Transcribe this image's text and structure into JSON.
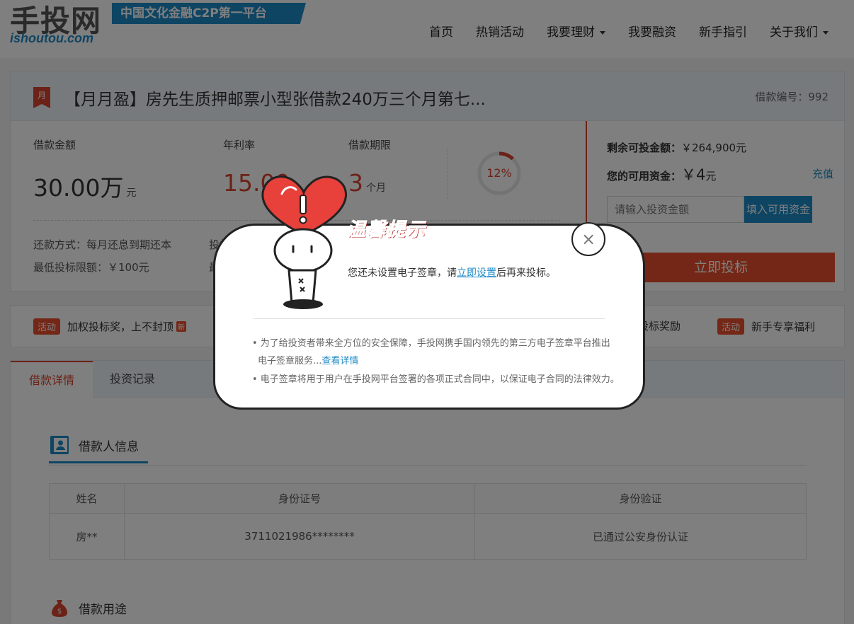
{
  "header": {
    "logo_cn": "手投网",
    "logo_en": "ishoutou.com",
    "slogan": "中国文化金融C2P第一平台",
    "nav": [
      {
        "label": "首页"
      },
      {
        "label": "热销活动"
      },
      {
        "label": "我要理财"
      },
      {
        "label": "我要融资"
      },
      {
        "label": "新手指引"
      },
      {
        "label": "关于我们"
      }
    ]
  },
  "loan": {
    "badge": "月",
    "title": "【月月盈】房先生质押邮票小型张借款240万三个月第七...",
    "loan_no": "借款编号：992",
    "amount_label": "借款金额",
    "amount_value": "30.00万",
    "amount_unit": "元",
    "rate_label": "年利率",
    "rate_value": "15.00",
    "term_label": "借款期限",
    "term_value": "3",
    "term_unit": "个月",
    "progress_text": "12%",
    "progress_value": 0.12,
    "repay_method": "还款方式：每月还息到期还本",
    "min_invest": "最低投标限额：￥100元",
    "reward": "投标奖励：无",
    "max_invest_prefix": "最高"
  },
  "invest_panel": {
    "remaining": "剩余可投金额：",
    "remaining_value": "￥264,900元",
    "available": "您的可用资金：",
    "available_value": "￥4",
    "available_unit": "元",
    "recharge": "充值",
    "input_placeholder": "请输入投资金额",
    "fill_button": "填入可用资金",
    "invest_button": "立即投标"
  },
  "activities": [
    {
      "tag": "活动",
      "text": "加权投标奖，上不封顶",
      "new": "新"
    },
    {
      "text": "投标奖励"
    },
    {
      "tag": "活动",
      "text": "新手专享福利"
    }
  ],
  "details": {
    "tabs": [
      "借款详情",
      "投资记录"
    ],
    "borrower_title": "借款人信息",
    "table_headers": [
      "姓名",
      "身份证号",
      "身份验证"
    ],
    "table_rows": [
      [
        "房**",
        "3711021986********",
        "已通过公安身份认证"
      ]
    ],
    "purpose_title": "借款用途"
  },
  "modal": {
    "title": "温馨提示",
    "msg_prefix": "您还未设置电子签章，请",
    "msg_link": "立即设置",
    "msg_suffix": "后再来投标。",
    "note1_line1": "• 为了给投资者带来全方位的安全保障，手投网携手国内领先的第三方电子签章平台推出",
    "note1_line2": "电子签章服务...",
    "note1_link": "查看详情",
    "note2": "• 电子签章将用于用户在手投网平台签署的各项正式合同中，以保证电子合同的法律效力。",
    "close_symbol": "×"
  },
  "colors": {
    "accent_blue": "#1d8ac7",
    "accent_red": "#d8452e",
    "button_red": "#e84e2c"
  }
}
